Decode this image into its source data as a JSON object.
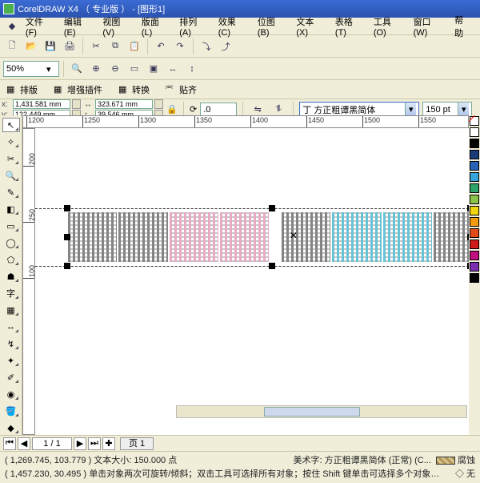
{
  "title": "CorelDRAW X4 （ 专业版 ） - [图形1]",
  "menus": [
    "文件(F)",
    "编辑(E)",
    "视图(V)",
    "版面(L)",
    "排列(A)",
    "效果(C)",
    "位图(B)",
    "文本(X)",
    "表格(T)",
    "工具(O)",
    "窗口(W)",
    "帮助"
  ],
  "zoom": "50%",
  "toolbar2": {
    "a": "排版",
    "b": "增强插件",
    "c": "转换",
    "d": "贴齐"
  },
  "prop": {
    "x": "1,431.581 mm",
    "y": "122.449 mm",
    "w": "323.671 mm",
    "h": "39.546 mm",
    "rot": ".0",
    "font": "方正粗谭黑简体",
    "size": "150 pt",
    "font_prefix": "丁"
  },
  "ruler_h": [
    "1200",
    "1250",
    "1300",
    "1350",
    "1400",
    "1450",
    "1500",
    "1550"
  ],
  "ruler_v": [
    "200",
    "250",
    "100"
  ],
  "page": {
    "nav_first": "⏮",
    "nav_prev": "◀",
    "num": "1 / 1",
    "nav_next": "▶",
    "nav_last": "⏭",
    "add": "✚",
    "tab": "页 1"
  },
  "status": {
    "line1_left": "( 1,269.745, 103.779 )  文本大小: 150.000 点",
    "line1_right": "美术字: 方正粗谭黑简体 (正常) (C...",
    "line1_fill": "腐蚀",
    "line2_left": "( 1,457.230, 30.495 )   单击对象两次可旋转/倾斜；双击工具可选择所有对象；按住 Shift 键单击可选择多个对象…",
    "line2_right": "无"
  },
  "colors": [
    "#ffffff",
    "#000000",
    "#1a3a7a",
    "#2a62b8",
    "#36a3d9",
    "#2fa36a",
    "#8bc34a",
    "#f2d50f",
    "#f29b0f",
    "#e24a1a",
    "#d11a1a",
    "#c01080",
    "#7a2fb0",
    "#000000"
  ],
  "icons": {
    "new": "🗋",
    "open": "📂",
    "save": "💾",
    "print": "🖨",
    "cut": "✂",
    "copy": "⧉",
    "paste": "📋",
    "undo": "↶",
    "redo": "↷",
    "search": "🔍",
    "zin": "⊕",
    "zout": "⊖",
    "fit": "▭"
  }
}
